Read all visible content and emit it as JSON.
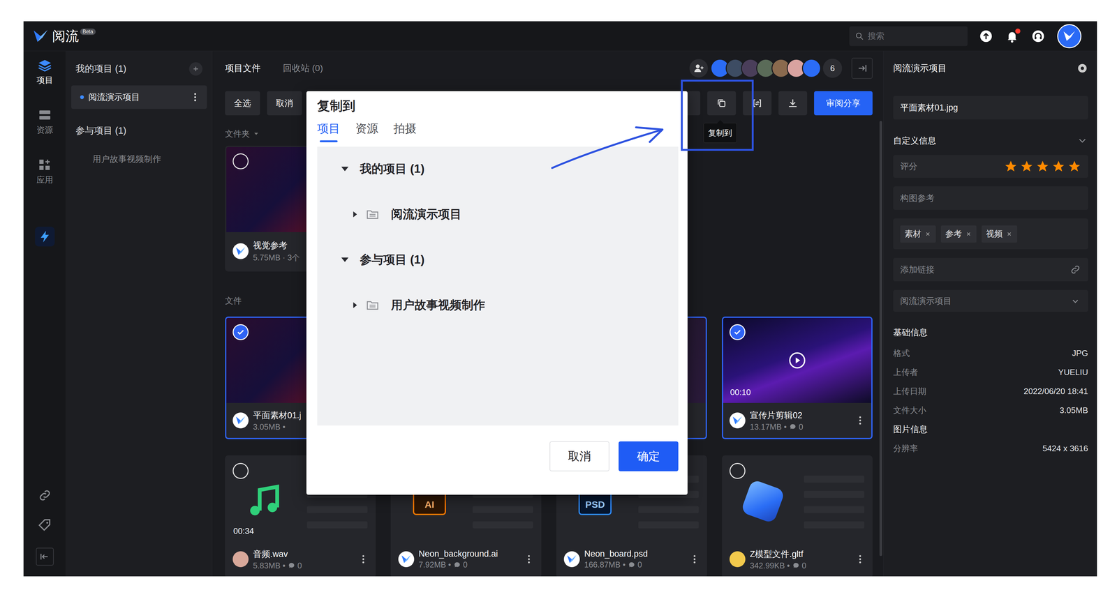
{
  "topbar": {
    "logo": "阅流",
    "badge": "Beta",
    "search_placeholder": "搜索",
    "has_notification": true
  },
  "rail": [
    {
      "label": "项目",
      "selected": true
    },
    {
      "label": "资源",
      "selected": false
    },
    {
      "label": "应用",
      "selected": false
    }
  ],
  "sidebar": {
    "groups": [
      {
        "title": "我的项目 (1)",
        "can_add": true,
        "items": [
          {
            "name": "阅流演示项目",
            "selected": true
          }
        ]
      },
      {
        "title": "参与项目 (1)",
        "can_add": false,
        "items": [
          {
            "name": "用户故事视频制作",
            "selected": false
          }
        ]
      }
    ]
  },
  "main": {
    "tabs": [
      {
        "label": "项目文件",
        "selected": true
      },
      {
        "label": "回收站 (0)",
        "selected": false
      }
    ],
    "avatars": [
      {
        "color": "#2b6cf6"
      },
      {
        "color": "#3d4c63"
      },
      {
        "color": "#4a3e5a"
      },
      {
        "color": "#5a6b58"
      },
      {
        "color": "#8a6a4e"
      },
      {
        "color": "#d9a3a0"
      },
      {
        "color": "#2b6cf6"
      }
    ],
    "member_count": "6",
    "toolbar": {
      "left": [
        {
          "label": "全选"
        },
        {
          "label": "取消"
        }
      ],
      "tooltip": "复制到",
      "share": "审阅分享"
    },
    "folder_label": "文件夹",
    "folders": [
      {
        "name": "视觉参考",
        "meta": "5.75MB · 3个",
        "selected": false
      }
    ],
    "file_label": "文件",
    "files": [
      {
        "kind": "image",
        "name": "平面素材01.j",
        "meta": "3.05MB •",
        "avatar": "logo",
        "selected": true
      },
      {
        "kind": "covered",
        "selected": false
      },
      {
        "kind": "covered",
        "selected": true
      },
      {
        "kind": "video",
        "name": "宣传片剪辑02",
        "meta": "13.17MB •",
        "comments": "0",
        "duration": "00:10",
        "avatar": "logo",
        "selected": true
      },
      {
        "kind": "audio",
        "name": "音频.wav",
        "meta": "5.83MB •",
        "comments": "0",
        "duration": "00:34",
        "avatar": "photo",
        "selected": false
      },
      {
        "kind": "ai",
        "name": "Neon_background.ai",
        "meta": "7.92MB •",
        "comments": "0",
        "badge": "AI",
        "avatar": "logo",
        "selected": false
      },
      {
        "kind": "psd",
        "name": "Neon_board.psd",
        "meta": "166.87MB •",
        "comments": "0",
        "badge": "PSD",
        "avatar": "logo",
        "selected": false
      },
      {
        "kind": "model",
        "name": "Z模型文件.gltf",
        "meta": "342.99KB •",
        "comments": "0",
        "avatar": "cartoon",
        "selected": false
      }
    ]
  },
  "details": {
    "title": "阅流演示项目",
    "file_name": "平面素材01.jpg",
    "custom_title": "自定义信息",
    "rating": {
      "label": "评分",
      "stars": 5,
      "max": 5
    },
    "composition": "构图参考",
    "tags": [
      {
        "label": "素材"
      },
      {
        "label": "参考"
      },
      {
        "label": "视频"
      }
    ],
    "link_placeholder": "添加链接",
    "project_select": "阅流演示项目",
    "basic_title": "基础信息",
    "basic": [
      {
        "label": "格式",
        "value": "JPG"
      },
      {
        "label": "上传者",
        "value": "YUELIU"
      },
      {
        "label": "上传日期",
        "value": "2022/06/20 18:41"
      },
      {
        "label": "文件大小",
        "value": "3.05MB"
      }
    ],
    "image_title": "图片信息",
    "image": [
      {
        "label": "分辨率",
        "value": "5424 x 3616"
      }
    ]
  },
  "modal": {
    "title": "复制到",
    "tabs": [
      {
        "label": "项目",
        "selected": true
      },
      {
        "label": "资源",
        "selected": false
      },
      {
        "label": "拍摄",
        "selected": false
      }
    ],
    "tree": [
      {
        "label": "我的项目 (1)",
        "expanded": true,
        "children": [
          {
            "label": "阅流演示项目",
            "expanded": false
          }
        ]
      },
      {
        "label": "参与项目 (1)",
        "expanded": true,
        "children": [
          {
            "label": "用户故事视频制作",
            "expanded": false
          }
        ]
      }
    ],
    "buttons": [
      {
        "label": "取消",
        "kind": "secondary"
      },
      {
        "label": "确定",
        "kind": "primary"
      }
    ]
  }
}
